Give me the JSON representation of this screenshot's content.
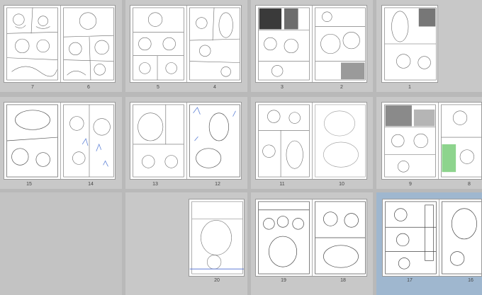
{
  "pages": {
    "p1": "1",
    "p2": "2",
    "p3": "3",
    "p4": "4",
    "p5": "5",
    "p6": "6",
    "p7": "7",
    "p8": "8",
    "p9": "9",
    "p10": "10",
    "p11": "11",
    "p12": "12",
    "p13": "13",
    "p14": "14",
    "p15": "15",
    "p16": "16",
    "p17": "17",
    "p18": "18",
    "p19": "19",
    "p20": "20"
  },
  "selected_spread": "17-16"
}
